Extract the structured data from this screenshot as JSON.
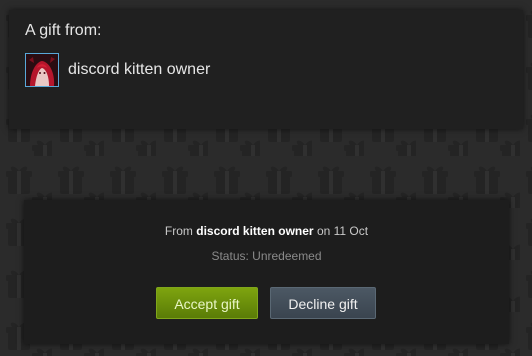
{
  "gift": {
    "heading": "A gift from:",
    "sender_name": "discord kitten owner",
    "avatar_icon": "profile-avatar-icon"
  },
  "details": {
    "from_prefix": "From",
    "from_sender": "discord kitten owner",
    "from_date_prefix": "on",
    "from_date": "11 Oct",
    "status": "Status: Unredeemed"
  },
  "actions": {
    "accept_label": "Accept gift",
    "decline_label": "Decline gift"
  },
  "colors": {
    "background": "#2b2b2b",
    "panel": "#202020",
    "accept": "#6a8f0c",
    "decline": "#434e59",
    "avatar_border": "#58a8d8"
  }
}
